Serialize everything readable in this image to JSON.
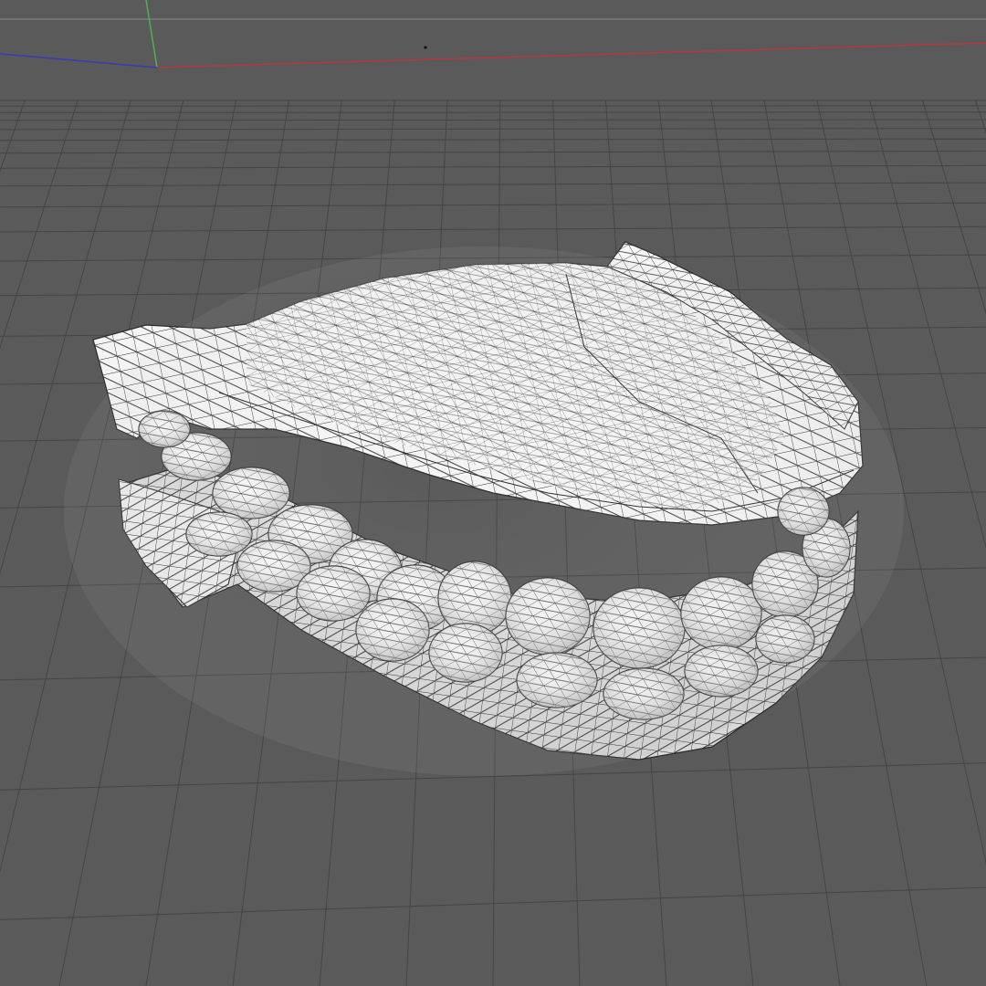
{
  "viewport": {
    "background": "#5a5a5a",
    "grid_color": "#3f3f3f",
    "floor_color": "#5d5d5d",
    "axis_x_color": "#b43a3a",
    "axis_y_color": "#4fb04f",
    "axis_z_color": "#3a3ab4",
    "horizon_color": "#8a8a8a"
  },
  "model": {
    "name": "dental-model",
    "fill": "#f3f3f3",
    "shade": "#d9d9d9",
    "wire_color": "#222222"
  }
}
